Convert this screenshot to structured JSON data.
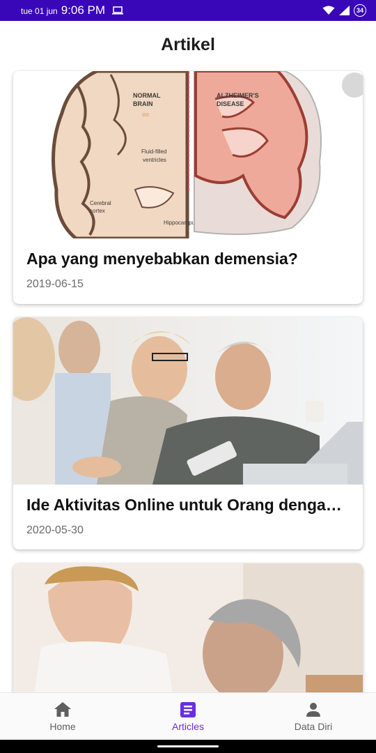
{
  "status_bar": {
    "date": "tue 01 jun",
    "time": "9:06 PM",
    "badge": "34"
  },
  "header": {
    "title": "Artikel"
  },
  "articles": [
    {
      "title": "Apa yang menyebabkan demensia?",
      "date": "2019-06-15",
      "image": {
        "left_label": "NORMAL BRAIN",
        "right_label": "ALZHEIMER'S DISEASE",
        "annotations": [
          "Fluid-filled ventricles",
          "Cerebral cortex",
          "Hippocampus"
        ]
      }
    },
    {
      "title": "Ide Aktivitas Online untuk Orang dengan …",
      "date": "2020-05-30"
    },
    {
      "title": "",
      "date": ""
    }
  ],
  "bottom_nav": {
    "items": [
      {
        "label": "Home",
        "icon": "home-icon"
      },
      {
        "label": "Articles",
        "icon": "article-icon",
        "active": true
      },
      {
        "label": "Data Diri",
        "icon": "person-icon"
      }
    ]
  },
  "colors": {
    "status_bar": "#3a07b8",
    "accent": "#6a2ee0"
  }
}
